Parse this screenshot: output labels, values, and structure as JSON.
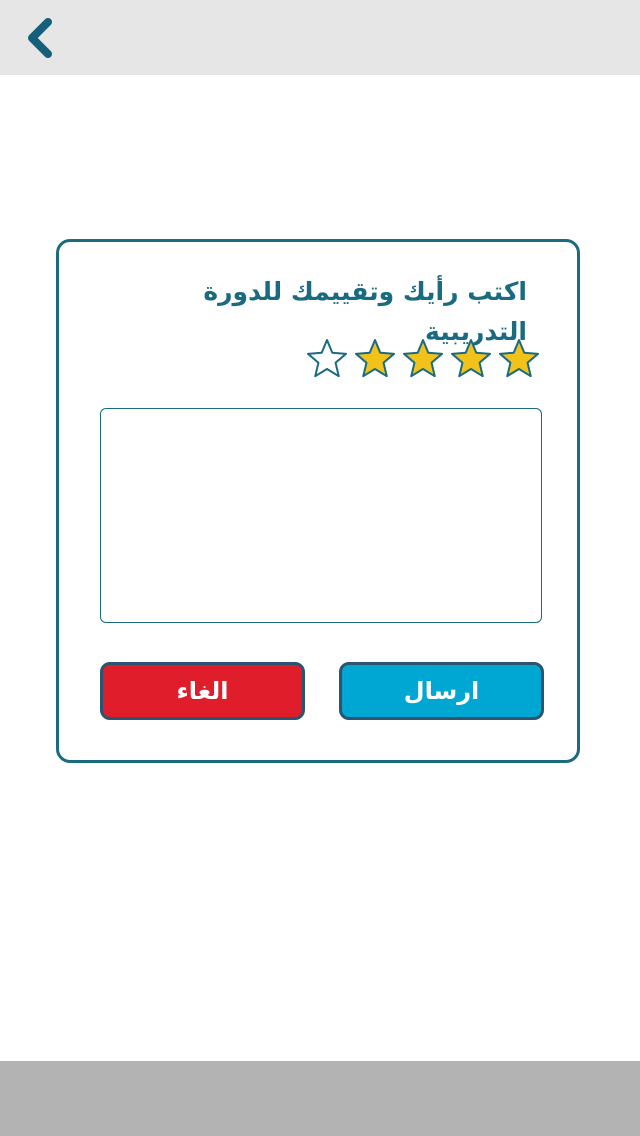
{
  "header": {
    "back_icon": "chevron-left-icon"
  },
  "card": {
    "title": "اكتب رأيك وتقييمك للدورة التدريبية",
    "rating": {
      "value": 4,
      "max": 5,
      "filled_color": "#f2c21b",
      "empty_color": "#ffffff",
      "outline_color": "#1a6a80"
    },
    "comment": {
      "value": "",
      "placeholder": ""
    },
    "buttons": {
      "send_label": "ارسال",
      "cancel_label": "الغاء",
      "send_color": "#00a7d3",
      "cancel_color": "#df1d2b"
    }
  },
  "colors": {
    "accent": "#1a6a80",
    "topbar": "#e6e6e6",
    "bottombar": "#b3b3b3"
  }
}
